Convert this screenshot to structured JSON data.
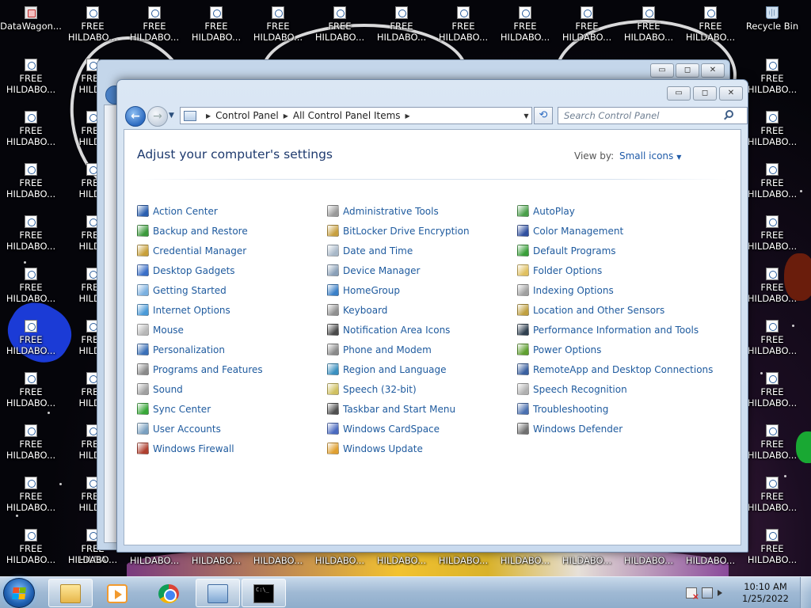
{
  "desktop": {
    "top_row": [
      {
        "label": "DataWagon...",
        "sub": "",
        "icon": "exe-icon"
      },
      {
        "label": "FREE",
        "sub": "HILDABO...",
        "icon": "file-icon"
      },
      {
        "label": "FREE",
        "sub": "HILDABO...",
        "icon": "file-icon"
      },
      {
        "label": "FREE",
        "sub": "HILDABO...",
        "icon": "file-icon"
      },
      {
        "label": "FREE",
        "sub": "HILDABO...",
        "icon": "file-icon"
      },
      {
        "label": "FREE",
        "sub": "HILDABO...",
        "icon": "file-icon"
      },
      {
        "label": "FREE",
        "sub": "HILDABO...",
        "icon": "file-icon"
      },
      {
        "label": "FREE",
        "sub": "HILDABO...",
        "icon": "file-icon"
      },
      {
        "label": "FREE",
        "sub": "HILDABO...",
        "icon": "file-icon"
      },
      {
        "label": "FREE",
        "sub": "HILDABO...",
        "icon": "file-icon"
      },
      {
        "label": "FREE",
        "sub": "HILDABO...",
        "icon": "file-icon"
      },
      {
        "label": "FREE",
        "sub": "HILDABO...",
        "icon": "file-icon"
      },
      {
        "label": "Recycle Bin",
        "sub": "",
        "icon": "recycle-bin-icon"
      }
    ],
    "left_label": "FREE",
    "left_sub": "HILDABO...",
    "partial_label": "FREE",
    "partial_sub": "HILDA",
    "right_label": "FREE",
    "right_sub": "HILDABO...",
    "bottom_label": "HILDABO..."
  },
  "window": {
    "minimize": "▭",
    "maximize": "◻",
    "close": "✕",
    "breadcrumb": [
      "Control Panel",
      "All Control Panel Items"
    ],
    "search_placeholder": "Search Control Panel",
    "heading": "Adjust your computer's settings",
    "view_by_label": "View by:",
    "view_by_value": "Small icons"
  },
  "items": {
    "col1": [
      {
        "label": "Action Center",
        "color": "#2a5fb0"
      },
      {
        "label": "Backup and Restore",
        "color": "#3c9a3c"
      },
      {
        "label": "Credential Manager",
        "color": "#c8a03a"
      },
      {
        "label": "Desktop Gadgets",
        "color": "#3a6fc8"
      },
      {
        "label": "Getting Started",
        "color": "#7ab0e0"
      },
      {
        "label": "Internet Options",
        "color": "#4a9ad8"
      },
      {
        "label": "Mouse",
        "color": "#b8b8b8"
      },
      {
        "label": "Personalization",
        "color": "#3a70b8"
      },
      {
        "label": "Programs and Features",
        "color": "#8a8a8a"
      },
      {
        "label": "Sound",
        "color": "#a0a0a0"
      },
      {
        "label": "Sync Center",
        "color": "#38a838"
      },
      {
        "label": "User Accounts",
        "color": "#7aa0c0"
      },
      {
        "label": "Windows Firewall",
        "color": "#b04030"
      }
    ],
    "col2": [
      {
        "label": "Administrative Tools",
        "color": "#9a9a9a"
      },
      {
        "label": "BitLocker Drive Encryption",
        "color": "#c8a040"
      },
      {
        "label": "Date and Time",
        "color": "#a8b8c8"
      },
      {
        "label": "Device Manager",
        "color": "#8aa0b8"
      },
      {
        "label": "HomeGroup",
        "color": "#3a80c8"
      },
      {
        "label": "Keyboard",
        "color": "#909090"
      },
      {
        "label": "Notification Area Icons",
        "color": "#4a4a4a"
      },
      {
        "label": "Phone and Modem",
        "color": "#8a8a8a"
      },
      {
        "label": "Region and Language",
        "color": "#3a90c0"
      },
      {
        "label": "Speech (32-bit)",
        "color": "#d0c060"
      },
      {
        "label": "Taskbar and Start Menu",
        "color": "#505050"
      },
      {
        "label": "Windows CardSpace",
        "color": "#4a6ac0"
      },
      {
        "label": "Windows Update",
        "color": "#e0a030"
      }
    ],
    "col3": [
      {
        "label": "AutoPlay",
        "color": "#4aa04a"
      },
      {
        "label": "Color Management",
        "color": "#3050a0"
      },
      {
        "label": "Default Programs",
        "color": "#3aa03a"
      },
      {
        "label": "Folder Options",
        "color": "#e0c060"
      },
      {
        "label": "Indexing Options",
        "color": "#a0a0a0"
      },
      {
        "label": "Location and Other Sensors",
        "color": "#c0a040"
      },
      {
        "label": "Performance Information and Tools",
        "color": "#304050"
      },
      {
        "label": "Power Options",
        "color": "#60a030"
      },
      {
        "label": "RemoteApp and Desktop Connections",
        "color": "#3a60a0"
      },
      {
        "label": "Speech Recognition",
        "color": "#b0b0b0"
      },
      {
        "label": "Troubleshooting",
        "color": "#4a70b0"
      },
      {
        "label": "Windows Defender",
        "color": "#707070"
      }
    ]
  },
  "taskbar": {
    "clock_time": "10:10 AM",
    "clock_date": "1/25/2022",
    "cmd_text": "C:\\_"
  }
}
